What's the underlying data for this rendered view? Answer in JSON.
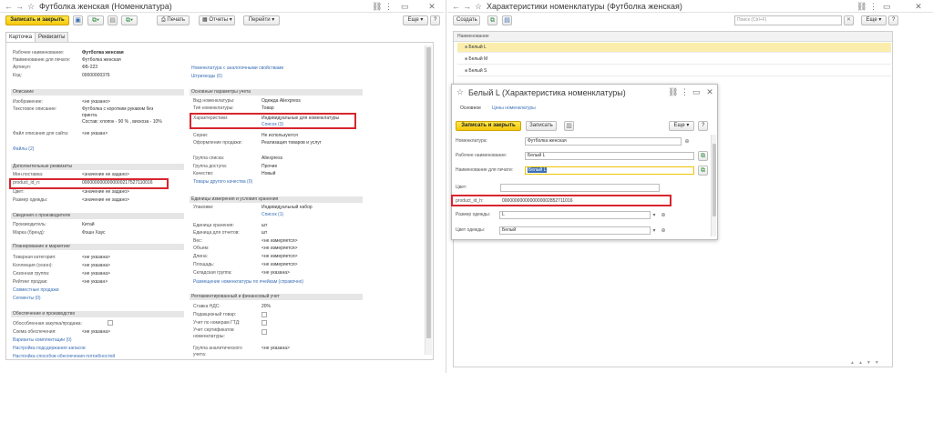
{
  "left": {
    "title": "Футболка женская (Номенклатура)",
    "tb": {
      "save_close": "Записать и закрыть",
      "print": "Печать",
      "reports": "Отчеты",
      "goto": "Перейти",
      "more": "Еще",
      "help": "?"
    },
    "tabs": [
      "Карточка",
      "Реквизиты"
    ],
    "top": {
      "work_name_l": "Рабочее наименование:",
      "work_name_v": "Футболка женская",
      "print_name_l": "Наименование для печати:",
      "print_name_v": "Футболка женская",
      "art_l": "Артикул:",
      "art_v": "ФБ-223",
      "code_l": "Код:",
      "code_v": "00000000376",
      "similar": "Номенклатура с аналогичными свойствами",
      "barcodes": "Штрихкоды (0)"
    },
    "desc": {
      "h": "Описание",
      "img_l": "Изображение:",
      "img_v": "<не указано>",
      "txt_l": "Текстовое описание:",
      "txt_v1": "Футболка с коротким рукавом без",
      "txt_v2": "принта.",
      "txt_v3": "Состав: хлопок - 90 % , вискоза - 10%",
      "site_l": "Файл описания для сайта:",
      "site_v": "<не указан>",
      "files": "Файлы (2)"
    },
    "main": {
      "h": "Основные параметры учета",
      "kind_l": "Вид номенклатуры:",
      "kind_v": "Одежда Aliexpress",
      "type_l": "Тип номенклатуры:",
      "type_v": "Товар",
      "char_l": "Характеристики:",
      "char_v": "Индивидуальные для номенклатуры",
      "char_link": "Список (3)",
      "series_l": "Серии:",
      "series_v": "Не используются",
      "sale_l": "Оформление продажи:",
      "sale_v": "Реализация товаров и услуг",
      "group_l": "Группа списка:",
      "group_v": "Aliexpress",
      "access_l": "Группа доступа:",
      "access_v": "Прочие",
      "quality_l": "Качество:",
      "quality_v": "Новый",
      "other_q": "Товары другого качества (0)"
    },
    "extra": {
      "h": "Дополнительные реквизиты",
      "min_l": "Мин.поставка:",
      "min_v": "<значение не задано>",
      "pid_l": "product_id_n:",
      "pid_v": "0000000000000000217527110016",
      "color_l": "Цвет:",
      "color_v": "<значение не задано>",
      "size_l": "Размер одежды:",
      "size_v": "<значение не задано>"
    },
    "units": {
      "h": "Единицы измерения и условия хранения",
      "pack_l": "Упаковки:",
      "pack_v": "Индивидуальный набор",
      "pack_link": "Список (1)",
      "store_l": "Единица хранения:",
      "store_v": "шт",
      "rep_l": "Единица для отчетов:",
      "rep_v": "шт",
      "w_l": "Вес:",
      "w_v": "<не измеряется>",
      "vol_l": "Объем:",
      "vol_v": "<не измеряется>",
      "len_l": "Длина:",
      "len_v": "<не измеряется>",
      "area_l": "Площадь:",
      "area_v": "<не измеряется>",
      "wh_l": "Складская группа:",
      "wh_v": "<не указана>",
      "cells": "Размещение номенклатуры по ячейкам (справочно)"
    },
    "maker": {
      "h": "Сведения о производителе",
      "prod_l": "Производитель:",
      "prod_v": "Китай",
      "brand_l": "Марка (бренд):",
      "brand_v": "Фэшн Хаус"
    },
    "plan": {
      "h": "Планирование и маркетинг",
      "cat_l": "Товарная категория:",
      "cat_v": "<не указана>",
      "coll_l": "Коллекция (сезон):",
      "coll_v": "<не указана>",
      "seas_l": "Сезонная группа:",
      "seas_v": "<не указана>",
      "rate_l": "Рейтинг продаж:",
      "rate_v": "<не указан>",
      "joint": "Совместные продажи",
      "segm": "Сегменты (0)"
    },
    "fin": {
      "h": "Регламентированный и финансовый учет",
      "vat_l": "Ставка НДС:",
      "vat_v": "20%",
      "sub_l": "Подакцизный товар:",
      "gtd_l": "Учет по номерам ГТД:",
      "cert_l1": "Учет сертификатов",
      "cert_l2": "номенклатуры:",
      "ana_l1": "Группа аналитического",
      "ana_l2": "учета:",
      "ana_v": "<не указана>"
    },
    "supply": {
      "h": "Обеспечение и производство",
      "sep_l": "Обособленная закупка/продажа:",
      "sch_l": "Схема обеспечения:",
      "sch_v": "<не указана>",
      "var": "Варианты комплектации (0)",
      "set": "Настройка подсдержания запасов",
      "last": "Настройка способов обеспечения потребностей"
    }
  },
  "right": {
    "title": "Характеристики номенклатуры (Футболка женская)",
    "tb": {
      "create": "Создать",
      "search_ph": "Поиск (Ctrl+F)",
      "more": "Еще",
      "help": "?"
    },
    "col": "Наименование",
    "rows": [
      "Белый L",
      "Белый M",
      "Белый S"
    ]
  },
  "dlg": {
    "title": "Белый L (Характеристика номенклатуры)",
    "tabs": [
      "Основное",
      "Цены номенклатуры"
    ],
    "save_close": "Записать и закрыть",
    "save": "Записать",
    "more": "Еще",
    "help": "?",
    "nom_l": "Номенклатура:",
    "nom_v": "Футболка женская",
    "work_l": "Рабочее наименование:",
    "work_v": "Белый L",
    "print_l": "Наименование для печати:",
    "print_v": "Белый L",
    "color_l": "Цвет:",
    "pid_l": "product_id_h:",
    "pid_v": "0000000000000000002852711016",
    "size_l": "Размер одежды:",
    "size_v": "L",
    "clr_l": "Цвет одежды:",
    "clr_v": "Белый"
  }
}
